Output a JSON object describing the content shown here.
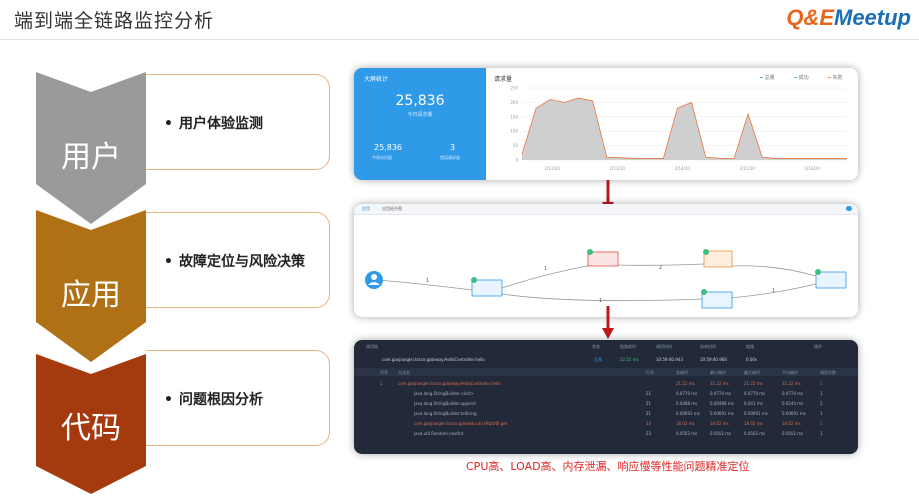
{
  "header": {
    "title": "端到端全链路监控分析",
    "logo_part1": "Q&E",
    "logo_part2": "Meetup"
  },
  "colors": {
    "chevron_user": "#9a9a9a",
    "chevron_app": "#b07015",
    "chevron_code": "#a43a0e",
    "card_border": "#e6b383",
    "arrow": "#c0161b",
    "caption": "#e02424"
  },
  "layers": [
    {
      "label": "用户",
      "item": "用户体验监测"
    },
    {
      "label": "应用",
      "item": "故障定位与风险决策"
    },
    {
      "label": "代码",
      "item": "问题根因分析"
    }
  ],
  "bullet": "•",
  "panel1": {
    "header": "大屏统计",
    "big_value": "25,836",
    "sub_label": "今日请求量",
    "stat1_value": "25,836",
    "stat1_label": "今周访问量",
    "stat2_value": "3",
    "stat2_label": "错误请求量",
    "chart_title": "请求量",
    "legend": [
      "总量",
      "成功",
      "失败"
    ],
    "chart_data": {
      "type": "area",
      "x": [
        "2/12/20",
        "2/13/20",
        "2/14/20",
        "2/15/20",
        "2/16/20"
      ],
      "yticks": [
        "0",
        "50",
        "100",
        "150",
        "200",
        "250"
      ],
      "ylim": [
        0,
        250
      ],
      "series": [
        {
          "name": "总量",
          "values": [
            20,
            180,
            210,
            200,
            215,
            205,
            10,
            8,
            5,
            6,
            5,
            180,
            200,
            10,
            6,
            5,
            160,
            10,
            5,
            5,
            5,
            5,
            5,
            5
          ]
        }
      ]
    }
  },
  "panel2": {
    "tab_left": "应用",
    "tab_right": "应用拓扑图",
    "edge_labels": [
      "1",
      "1",
      "2",
      "1",
      "1"
    ]
  },
  "panel3": {
    "head": [
      "调用链",
      "状态",
      "链路耗时",
      "调用时间",
      "结束时间",
      "链路",
      "操作"
    ],
    "top_row": [
      "com.gaojianglei.trace.gateway.HelloController.hello",
      "正常",
      "22.55 ms",
      "10:59:40.943",
      "10:59:40.966",
      "0.00s"
    ],
    "sub_head": [
      "序号",
      "方法名",
      "行号",
      "总耗时",
      "最小耗时",
      "最大耗时",
      "平均耗时",
      "调用次数"
    ],
    "rows": [
      [
        "1",
        "com.gaojianglei.trace.gateway.HelloController.hello",
        "",
        "21.22 ms",
        "21.22 ms",
        "21.22 ms",
        "21.22 ms",
        "1"
      ],
      [
        "",
        "java.lang.StringBuilder.<init>",
        "21",
        "0.0770 ms",
        "0.0770 ms",
        "0.0770 ms",
        "0.0770 ms",
        "1"
      ],
      [
        "",
        "java.lang.StringBuilder.append",
        "21",
        "0.0488 ms",
        "0.00488 ms",
        "0.041 ms",
        "0.0244 ms",
        "2"
      ],
      [
        "",
        "java.lang.StringBuilder.toString",
        "21",
        "0.00691 ms",
        "0.00691 ms",
        "0.00691 ms",
        "0.00691 ms",
        "1"
      ],
      [
        "",
        "com.gaojianglei.trace.gateway.util.HttpUtil.get",
        "22",
        "18.02 ms",
        "18.02 ms",
        "18.02 ms",
        "18.02 ms",
        "1"
      ],
      [
        "",
        "java.util.Random.nextInt",
        "23",
        "0.0502 ms",
        "0.0502 ms",
        "0.0502 ms",
        "0.0502 ms",
        "1"
      ]
    ]
  },
  "caption": "CPU高、LOAD高、内存泄漏、响应慢等性能问题精准定位"
}
